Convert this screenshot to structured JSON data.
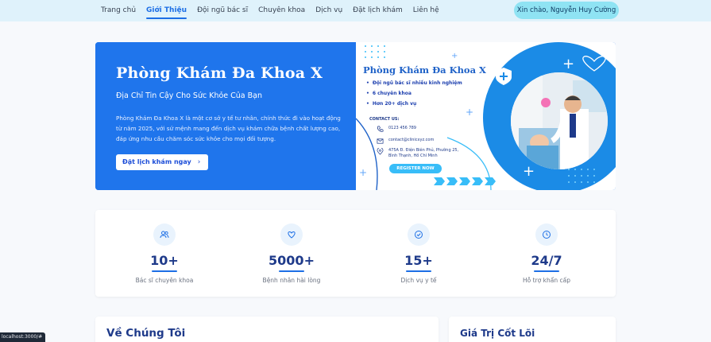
{
  "nav": {
    "links": [
      "Trang chủ",
      "Giới Thiệu",
      "Đội ngũ bác sĩ",
      "Chuyên khoa",
      "Dịch vụ",
      "Đặt lịch khám",
      "Liên hệ"
    ],
    "active_index": 1,
    "greeting": "Xin chào, Nguyễn Huy Cường"
  },
  "hero": {
    "title": "Phòng Khám Đa Khoa X",
    "subtitle": "Địa Chỉ Tin Cậy Cho Sức Khỏe Của Bạn",
    "description": "Phòng Khám Đa Khoa X là một cơ sở y tế tư nhân, chính thức đi vào hoạt động từ năm 2025, với sứ mệnh mang đến dịch vụ khám chữa bệnh chất lượng cao, đáp ứng nhu cầu chăm sóc sức khỏe cho mọi đối tượng.",
    "cta_label": "Đặt lịch khám ngay",
    "cta_chevron": "›",
    "banner": {
      "title": "Phòng Khám Đa Khoa X",
      "bullets": [
        "Đội ngũ bác sĩ nhiều kinh nghiệm",
        "6 chuyên khoa",
        "Hơn 20+ dịch vụ"
      ],
      "contact_label": "CONTACT US:",
      "phone": "0123 456 789",
      "email": "contact@clinicxyz.com",
      "address_line1": "475A Đ. Điện Biên Phủ, Phường 25,",
      "address_line2": "Bình Thạnh, Hồ Chí Minh",
      "register_label": "REGISTER NOW"
    }
  },
  "stats": [
    {
      "icon": "users-icon",
      "value": "10+",
      "label": "Bác sĩ chuyên khoa"
    },
    {
      "icon": "heart-icon",
      "value": "5000+",
      "label": "Bệnh nhân hài lòng"
    },
    {
      "icon": "check-circle-icon",
      "value": "15+",
      "label": "Dịch vụ y tế"
    },
    {
      "icon": "clock-icon",
      "value": "24/7",
      "label": "Hỗ trợ khẩn cấp"
    }
  ],
  "sections": {
    "about_title": "Về Chúng Tôi",
    "values_title": "Giá Trị Cốt Lõi"
  },
  "status_url": "localhost:3000/#",
  "colors": {
    "primary": "#1d6fe5",
    "nav_bg": "#dff2fb",
    "greeting_bg": "#8fe3f3",
    "heading": "#1e3a8a",
    "accent_cyan": "#38bdf8"
  }
}
